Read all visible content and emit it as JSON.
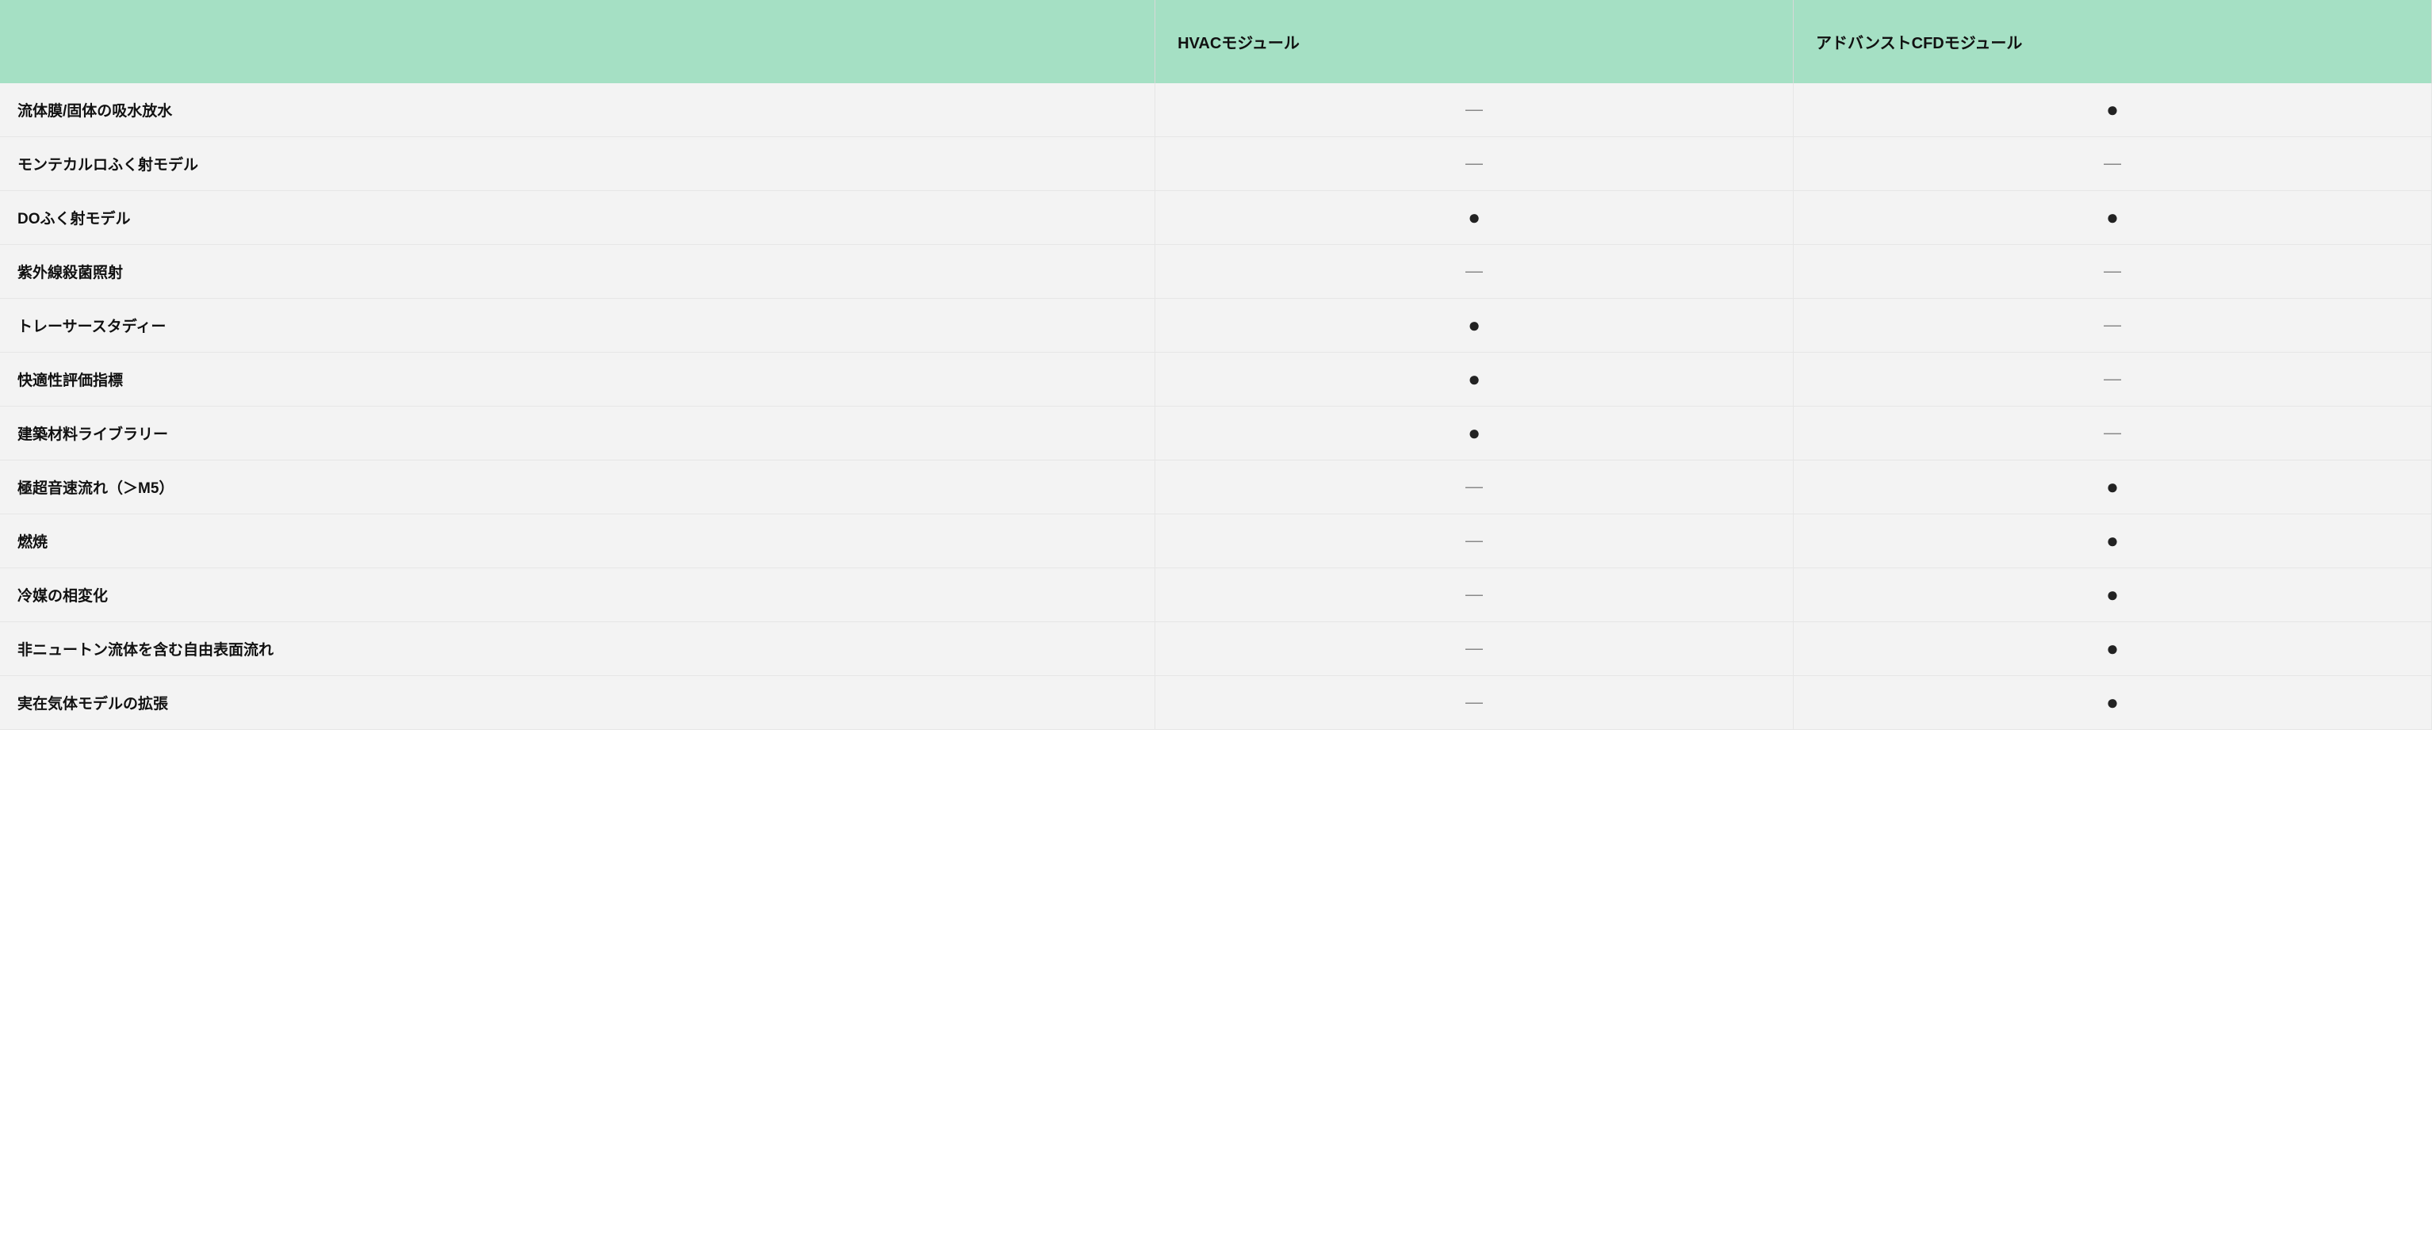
{
  "columns": [
    "",
    "HVACモジュール",
    "アドバンストCFDモジュール"
  ],
  "symbols": {
    "dot": "●",
    "dash": "—"
  },
  "rows": [
    {
      "feature": "流体膜/固体の吸水放水",
      "hvac": "dash",
      "adv": "dot"
    },
    {
      "feature": "モンテカルロふく射モデル",
      "hvac": "dash",
      "adv": "dash"
    },
    {
      "feature": "DOふく射モデル",
      "hvac": "dot",
      "adv": "dot"
    },
    {
      "feature": "紫外線殺菌照射",
      "hvac": "dash",
      "adv": "dash"
    },
    {
      "feature": "トレーサースタディー",
      "hvac": "dot",
      "adv": "dash"
    },
    {
      "feature": "快適性評価指標",
      "hvac": "dot",
      "adv": "dash"
    },
    {
      "feature": "建築材料ライブラリー",
      "hvac": "dot",
      "adv": "dash"
    },
    {
      "feature": "極超音速流れ（＞M5）",
      "hvac": "dash",
      "adv": "dot"
    },
    {
      "feature": "燃焼",
      "hvac": "dash",
      "adv": "dot"
    },
    {
      "feature": "冷媒の相変化",
      "hvac": "dash",
      "adv": "dot"
    },
    {
      "feature": "非ニュートン流体を含む自由表面流れ",
      "hvac": "dash",
      "adv": "dot"
    },
    {
      "feature": "実在気体モデルの拡張",
      "hvac": "dash",
      "adv": "dot"
    }
  ]
}
